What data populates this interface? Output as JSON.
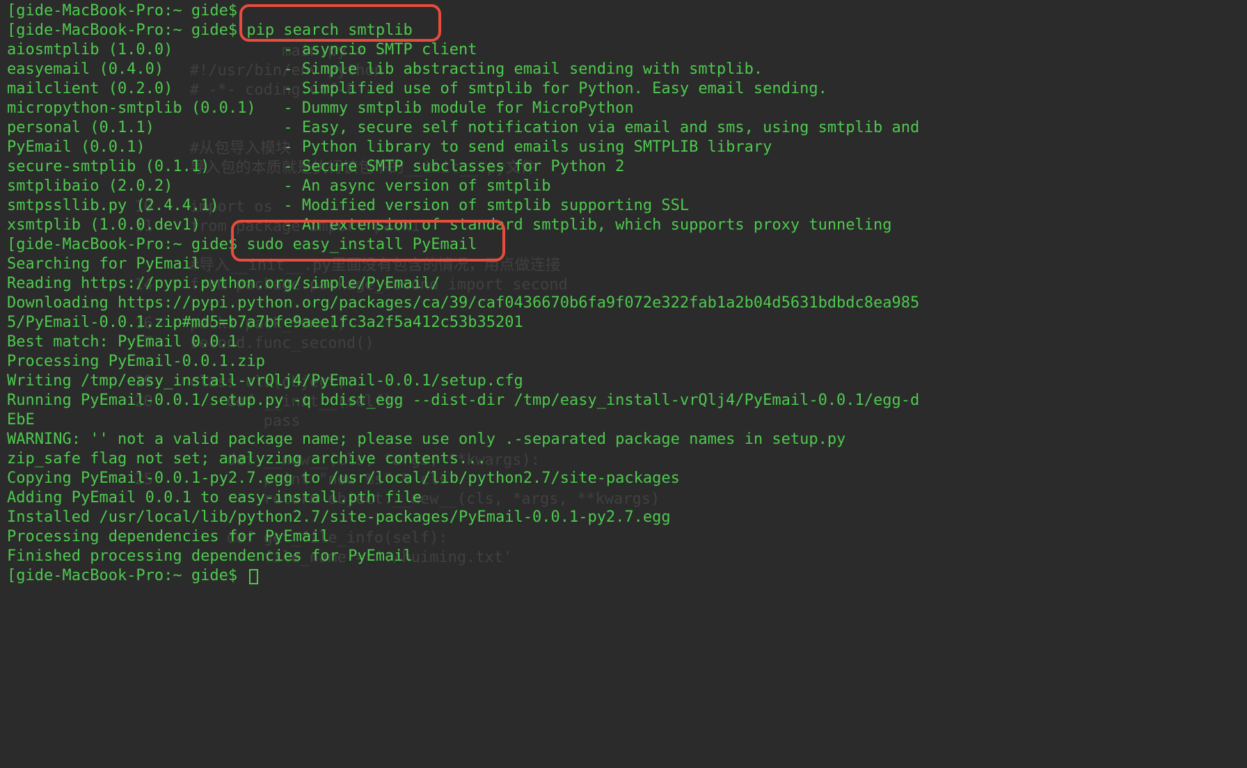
{
  "prompt": {
    "host": "gide-MacBook-Pro:~ gide$"
  },
  "commands": {
    "empty": "",
    "pip_search": "pip search smtplib",
    "sudo_install": "sudo easy_install PyEmail"
  },
  "search_results": [
    {
      "name": "aiosmtplib (1.0.0)",
      "desc": "asyncio SMTP client"
    },
    {
      "name": "easyemail (0.4.0)",
      "desc": "Simple lib abstracting email sending with smtplib."
    },
    {
      "name": "mailclient (0.2.0)",
      "desc": "Simplified use of smtplib for Python. Easy email sending."
    },
    {
      "name": "micropython-smtplib (0.0.1)",
      "desc": "Dummy smtplib module for MicroPython"
    },
    {
      "name": "personal (0.1.1)",
      "desc": "Easy, secure self notification via email and sms, using smtplib and "
    },
    {
      "name": "PyEmail (0.0.1)",
      "desc": "Python library to send emails using SMTPLIB library"
    },
    {
      "name": "secure-smtplib (0.1.1)",
      "desc": "Secure SMTP subclasses for Python 2"
    },
    {
      "name": "smtplibaio (2.0.2)",
      "desc": "An async version of smtplib"
    },
    {
      "name": "smtpssllib.py (2.4.4.1)",
      "desc": "Modified version of smtplib supporting SSL"
    },
    {
      "name": "xsmtplib (1.0.0.dev1)",
      "desc": "An extension of standard smtplib, which supports proxy tunneling"
    }
  ],
  "install_output": [
    "Searching for PyEmail",
    "Reading https://pypi.python.org/simple/PyEmail/",
    "Downloading https://pypi.python.org/packages/ca/39/caf0436670b6fa9f072e322fab1a2b04d5631bdbdc8ea985",
    "5/PyEmail-0.0.1.zip#md5=b7a7bfe9aee1fc3a2f5a412c53b35201",
    "Best match: PyEmail 0.0.1",
    "Processing PyEmail-0.0.1.zip",
    "Writing /tmp/easy_install-vrQlj4/PyEmail-0.0.1/setup.cfg",
    "Running PyEmail-0.0.1/setup.py -q bdist_egg --dist-dir /tmp/easy_install-vrQlj4/PyEmail-0.0.1/egg-d",
    "EbE",
    "WARNING: '' not a valid package name; please use only .-separated package names in setup.py",
    "zip_safe flag not set; analyzing archive contents...",
    "Copying PyEmail-0.0.1-py2.7.egg to /usr/local/lib/python2.7/site-packages",
    "Adding PyEmail 0.0.1 to easy-install.pth file",
    "",
    "Installed /usr/local/lib/python2.7/site-packages/PyEmail-0.0.1-py2.7.egg",
    "Processing dependencies for PyEmail",
    "Finished processing dependencies for PyEmail"
  ],
  "ghost_lines": [
    {
      "ln": "",
      "text": "          main.py ×"
    },
    {
      "ln": "",
      "text": "#!/usr/bin/env python"
    },
    {
      "ln": "",
      "text": "# -*- coding:utf-8 -*-"
    },
    {
      "ln": "",
      "text": ""
    },
    {
      "ln": "",
      "text": ""
    },
    {
      "ln": "",
      "text": "#从包导入模块"
    },
    {
      "ln": "",
      "text": "导入包的本质就是执行该包下的__init__.py文件"
    },
    {
      "ln": "",
      "text": ""
    },
    {
      "ln": "10",
      "text": "import os"
    },
    {
      "ln": "11",
      "text": "from package import pack1"
    },
    {
      "ln": "",
      "text": ""
    },
    {
      "ln": "",
      "text": "#导入__init__.py里面没有包含的情况，用点做连接"
    },
    {
      "ln": "14",
      "text": "from package.package_second import second"
    },
    {
      "ln": "",
      "text": ""
    },
    {
      "ln": "16",
      "text": "pack1.pack_func()"
    },
    {
      "ln": "17",
      "text": "second.func_second()"
    },
    {
      "ln": "",
      "text": ""
    },
    {
      "ln": "19",
      "text": "class cls(object):"
    },
    {
      "ln": "20",
      "text": "    def __init__(self):"
    },
    {
      "ln": "",
      "text": "        pass"
    },
    {
      "ln": "",
      "text": ""
    },
    {
      "ln": "",
      "text": "    def __new__(cls, *args, **kwargs):"
    },
    {
      "ln": "25",
      "text": "        print \"new %s\" % cls"
    },
    {
      "ln": "",
      "text": "        return object.__new__(cls, *args, **kwargs)"
    },
    {
      "ln": "",
      "text": ""
    },
    {
      "ln": "",
      "text": "    def get_file_info(self):"
    },
    {
      "ln": "",
      "text": "        file_name = './huiming.txt'"
    }
  ]
}
